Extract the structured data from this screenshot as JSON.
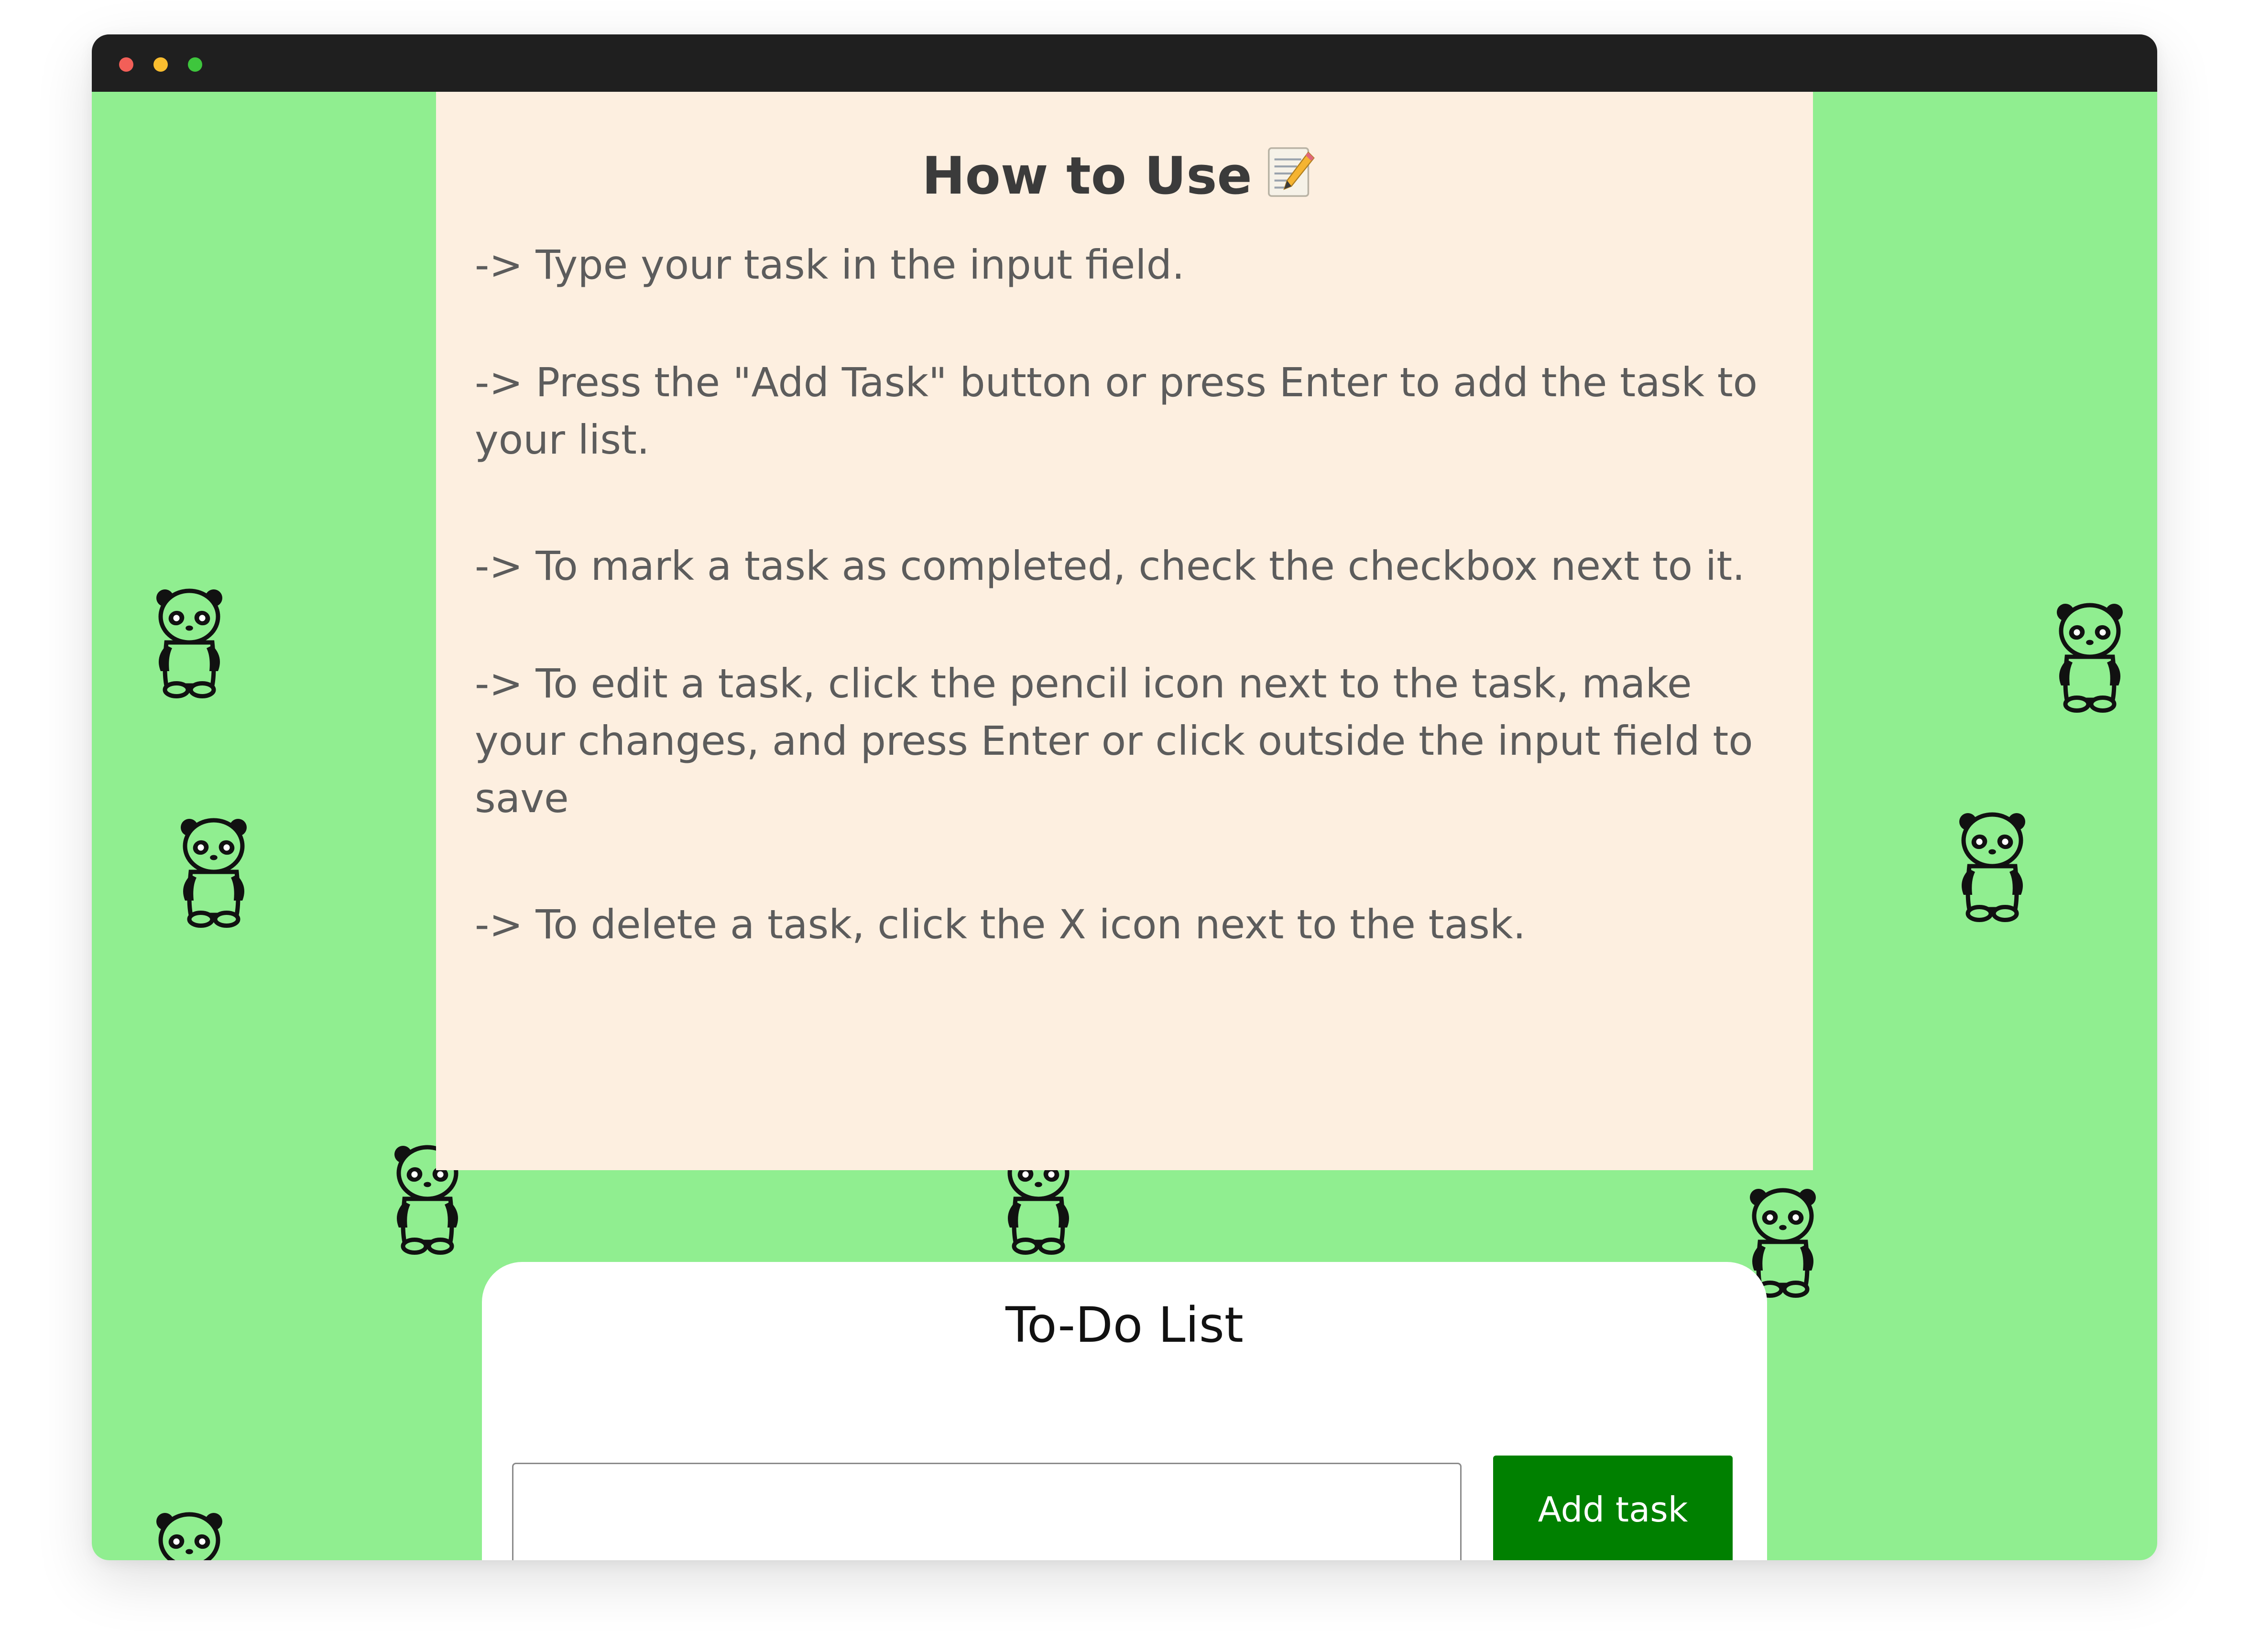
{
  "window": {
    "controls": [
      "close",
      "minimize",
      "zoom"
    ]
  },
  "background": {
    "color": "#90ee90",
    "decoration_icon": "panda-icon"
  },
  "instructions": {
    "title": "How to Use",
    "title_icon": "memo-icon",
    "steps": [
      "-> Type your task in the input field.",
      "-> Press the \"Add Task\" button or press Enter to add the task to your list.",
      "-> To mark a task as completed, check the checkbox next to it.",
      "-> To edit a task, click the pencil icon next to the task, make your changes, and press Enter or click outside the input field to save",
      "-> To delete a task, click the X icon next to the task."
    ],
    "background_color": "#fdefe0"
  },
  "todo": {
    "title": "To-Do List",
    "input_value": "",
    "add_button_label": "Add task",
    "button_color": "#008000"
  }
}
